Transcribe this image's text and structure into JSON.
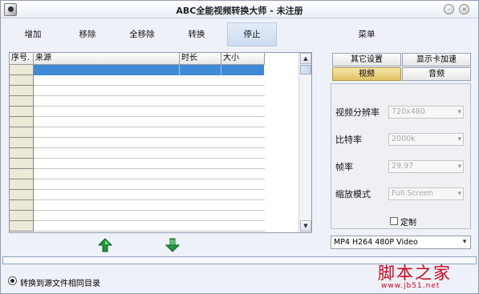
{
  "window": {
    "title": "ABC全能视频转换大师 - 未注册"
  },
  "toolbar": {
    "add": "增加",
    "remove": "移除",
    "remove_all": "全移除",
    "convert": "转换",
    "stop": "停止",
    "menu": "菜单"
  },
  "table": {
    "columns": {
      "index": "序号.",
      "source": "来源",
      "duration": "时长",
      "size": "大小"
    }
  },
  "tabs": {
    "other_settings": "其它设置",
    "gpu_accel": "显示卡加速",
    "video": "视频",
    "audio": "音频"
  },
  "video_settings": {
    "resolution_label": "视频分辨率",
    "resolution_value": "720x480",
    "bitrate_label": "比特率",
    "bitrate_value": "2000k",
    "framerate_label": "帧率",
    "framerate_value": "29.97",
    "zoom_label": "缩放模式",
    "zoom_value": "Full Screen",
    "custom_label": "定制"
  },
  "preset": {
    "selected": "MP4 H264 480P Video"
  },
  "progress": {
    "percent": 0
  },
  "output": {
    "same_dir_label": "转换到源文件相同目录"
  },
  "watermark": {
    "main": "脚本之家",
    "sub": "www.jb51.net"
  },
  "colors": {
    "selection": "#3f8ad6",
    "selected_tab": "#e0c164",
    "watermark": "#d0021b",
    "arrow_green": "#1a9a3a"
  },
  "icons": {
    "move_up": "green-up-arrow-icon",
    "move_down": "green-down-arrow-icon"
  }
}
